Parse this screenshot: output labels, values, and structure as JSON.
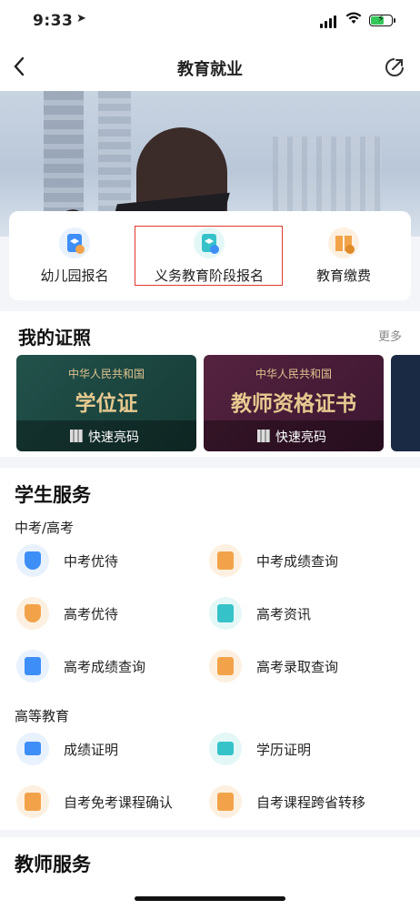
{
  "status_bar": {
    "time": "9:33"
  },
  "nav": {
    "title": "教育就业"
  },
  "quick_actions": [
    {
      "label": "幼儿园报名",
      "icon": "kindergarten-enroll-icon",
      "color": "#3e8ef7"
    },
    {
      "label": "义务教育阶段报名",
      "icon": "compulsory-education-enroll-icon",
      "color": "#35c3c9"
    },
    {
      "label": "教育缴费",
      "icon": "education-payment-icon",
      "color": "#f2a34a"
    }
  ],
  "certificates": {
    "title": "我的证照",
    "more": "更多",
    "cards": [
      {
        "issuer": "中华人民共和国",
        "name": "学位证",
        "action": "快速亮码",
        "color": "#1e4a44"
      },
      {
        "issuer": "中华人民共和国",
        "name": "教师资格证书",
        "action": "快速亮码",
        "color": "#4a1f3a"
      }
    ]
  },
  "student_services": {
    "title": "学生服务",
    "groups": [
      {
        "name": "中考/高考",
        "items": [
          {
            "label": "中考优待",
            "icon": "graduation-cap-icon",
            "color": "#3e8ef7"
          },
          {
            "label": "中考成绩查询",
            "icon": "score-search-icon",
            "color": "#f2a34a"
          },
          {
            "label": "高考优待",
            "icon": "graduation-cap-icon",
            "color": "#f2a34a"
          },
          {
            "label": "高考资讯",
            "icon": "news-icon",
            "color": "#35c3c9"
          },
          {
            "label": "高考成绩查询",
            "icon": "document-search-icon",
            "color": "#3e8ef7"
          },
          {
            "label": "高考录取查询",
            "icon": "admission-search-icon",
            "color": "#f2a34a"
          }
        ]
      },
      {
        "name": "高等教育",
        "items": [
          {
            "label": "成绩证明",
            "icon": "certificate-icon",
            "color": "#3e8ef7"
          },
          {
            "label": "学历证明",
            "icon": "diploma-icon",
            "color": "#35c3c9"
          },
          {
            "label": "自考免考课程确认",
            "icon": "document-search-icon",
            "color": "#f2a34a"
          },
          {
            "label": "自考课程跨省转移",
            "icon": "transfer-check-icon",
            "color": "#f2a34a"
          }
        ]
      }
    ]
  },
  "teacher_services": {
    "title": "教师服务"
  }
}
